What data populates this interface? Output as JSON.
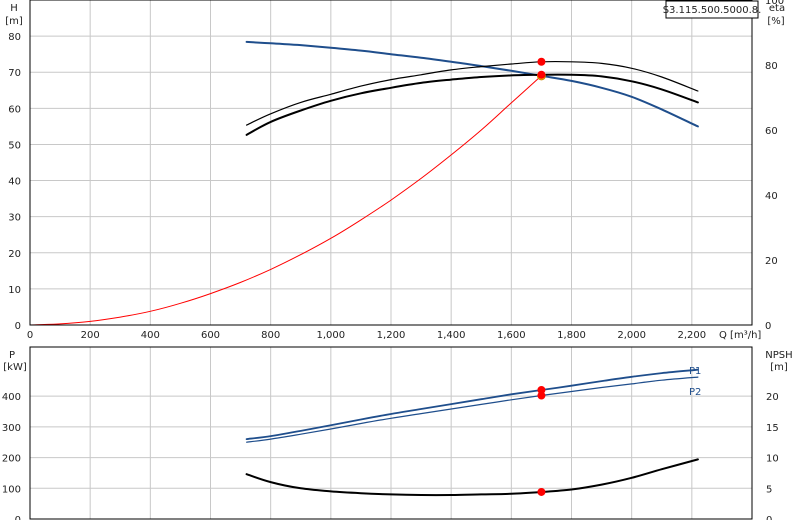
{
  "chart_data": [
    {
      "type": "line",
      "title": "S3.115.500.5000.8.",
      "xlabel": "Q [m³/h]",
      "ylabel": "H",
      "ylabel_unit": "[m]",
      "y2label": "eta",
      "y2label_unit": "[%]",
      "xlim": [
        0,
        2400
      ],
      "ylim": [
        0,
        90
      ],
      "y2lim": [
        0,
        100
      ],
      "x_ticks": [
        0,
        200,
        400,
        600,
        800,
        1000,
        1200,
        1400,
        1600,
        1800,
        2000,
        2200
      ],
      "x_tick_labels": [
        "0",
        "200",
        "400",
        "600",
        "800",
        "1,000",
        "1,200",
        "1,400",
        "1,600",
        "1,800",
        "2,000",
        "2,200"
      ],
      "y_ticks": [
        0,
        10,
        20,
        30,
        40,
        50,
        60,
        70,
        80
      ],
      "y2_ticks": [
        0,
        20,
        40,
        60,
        80,
        100
      ],
      "grid": true,
      "series": [
        {
          "key": "H",
          "axis": "left",
          "color": "#1f4e8c",
          "width": 2,
          "x": [
            720,
            800,
            900,
            1000,
            1100,
            1200,
            1300,
            1400,
            1500,
            1600,
            1700,
            1800,
            1900,
            2000,
            2100,
            2220
          ],
          "y": [
            78.4,
            78.0,
            77.5,
            76.8,
            76.0,
            75.0,
            74.0,
            72.9,
            71.7,
            70.4,
            69.0,
            67.6,
            65.7,
            63.2,
            59.7,
            55.0
          ]
        },
        {
          "key": "eta_upper",
          "axis": "right",
          "color": "#000000",
          "width": 1.2,
          "x": [
            720,
            800,
            900,
            1000,
            1100,
            1200,
            1300,
            1400,
            1500,
            1600,
            1700,
            1800,
            1900,
            2000,
            2100,
            2220
          ],
          "y": [
            61.5,
            65,
            68.5,
            71,
            73.5,
            75.5,
            77,
            78.5,
            79.5,
            80.3,
            81,
            81,
            80.5,
            79,
            76.3,
            72
          ]
        },
        {
          "key": "eta_lower",
          "axis": "right",
          "color": "#000000",
          "width": 2,
          "x": [
            720,
            800,
            900,
            1000,
            1100,
            1200,
            1300,
            1400,
            1500,
            1600,
            1700,
            1800,
            1900,
            2000,
            2100,
            2220
          ],
          "y": [
            58.5,
            62.5,
            66,
            69,
            71.3,
            73,
            74.5,
            75.5,
            76.3,
            76.8,
            77,
            77,
            76.5,
            75,
            72.5,
            68.5
          ]
        },
        {
          "key": "system_curve",
          "axis": "left",
          "color": "#ff0000",
          "width": 1,
          "x": [
            0,
            100,
            200,
            300,
            400,
            500,
            600,
            700,
            800,
            900,
            1000,
            1100,
            1200,
            1300,
            1400,
            1500,
            1600,
            1700
          ],
          "y": [
            0,
            0.3,
            1.0,
            2.2,
            3.8,
            6.0,
            8.7,
            11.8,
            15.4,
            19.5,
            24.0,
            29.1,
            34.6,
            40.6,
            47.1,
            54.0,
            61.5,
            69.0
          ]
        }
      ],
      "markers": [
        {
          "axis": "left",
          "x": 1700,
          "y": 69.0,
          "fill": "#ffd700",
          "stroke": "#cc8800",
          "r": 4
        },
        {
          "axis": "right",
          "x": 1700,
          "y": 81.0,
          "fill": "#ff0000",
          "stroke": "#ff0000",
          "r": 3.5
        },
        {
          "axis": "right",
          "x": 1700,
          "y": 77.0,
          "fill": "#ff0000",
          "stroke": "#ff0000",
          "r": 3.5
        }
      ]
    },
    {
      "type": "line",
      "ylabel": "P",
      "ylabel_unit": "[kW]",
      "y2label": "NPSH",
      "y2label_unit": "[m]",
      "xlim": [
        0,
        2400
      ],
      "ylim": [
        0,
        560
      ],
      "y2lim": [
        0,
        28
      ],
      "y_ticks": [
        0,
        100,
        200,
        300,
        400
      ],
      "y2_ticks": [
        0,
        5,
        10,
        15,
        20
      ],
      "grid": true,
      "series": [
        {
          "key": "P1",
          "name": "P1",
          "axis": "left",
          "color": "#1f4e8c",
          "width": 1.8,
          "x": [
            720,
            800,
            900,
            1000,
            1100,
            1200,
            1300,
            1400,
            1500,
            1600,
            1700,
            1800,
            1900,
            2000,
            2100,
            2220
          ],
          "y": [
            260,
            270,
            287,
            305,
            324,
            342,
            358,
            374,
            390,
            406,
            420,
            434,
            449,
            463,
            475,
            486
          ]
        },
        {
          "key": "P2",
          "name": "P2",
          "axis": "left",
          "color": "#1f4e8c",
          "width": 1.2,
          "x": [
            720,
            800,
            900,
            1000,
            1100,
            1200,
            1300,
            1400,
            1500,
            1600,
            1700,
            1800,
            1900,
            2000,
            2100,
            2220
          ],
          "y": [
            250,
            260,
            276,
            293,
            311,
            328,
            343,
            358,
            373,
            388,
            402,
            415,
            428,
            440,
            452,
            462
          ]
        },
        {
          "key": "NPSH",
          "axis": "right",
          "color": "#000000",
          "width": 2,
          "x": [
            720,
            800,
            900,
            1000,
            1100,
            1200,
            1300,
            1400,
            1500,
            1600,
            1700,
            1800,
            1900,
            2000,
            2100,
            2220
          ],
          "y": [
            7.3,
            6.0,
            5.0,
            4.5,
            4.2,
            4.0,
            3.9,
            3.9,
            4.0,
            4.1,
            4.4,
            4.8,
            5.6,
            6.7,
            8.1,
            9.7
          ]
        }
      ],
      "markers": [
        {
          "axis": "left",
          "x": 1700,
          "y": 420,
          "fill": "#ff0000",
          "stroke": "#ff0000",
          "r": 3.5
        },
        {
          "axis": "left",
          "x": 1700,
          "y": 402,
          "fill": "#ff0000",
          "stroke": "#ff0000",
          "r": 3.5
        },
        {
          "axis": "right",
          "x": 1700,
          "y": 4.4,
          "fill": "#ff0000",
          "stroke": "#ff0000",
          "r": 3.5
        }
      ]
    }
  ]
}
